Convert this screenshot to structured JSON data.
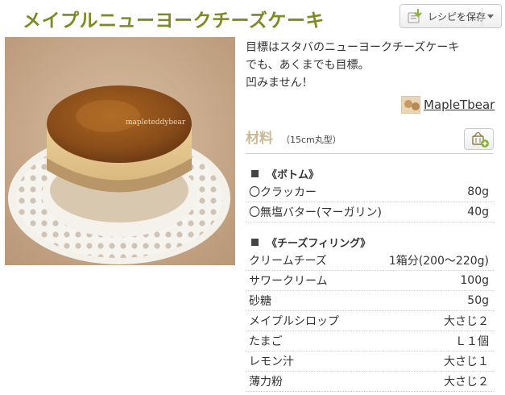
{
  "recipe": {
    "title": "メイプルニューヨークチーズケーキ",
    "description": [
      "目標はスタバのニューヨークチーズケーキ",
      "でも、あくまでも目標。",
      "凹みません！"
    ],
    "author": "MapleTbear",
    "photo_watermark": "mapleteddybear"
  },
  "toolbar": {
    "save_label": "レシピを保存"
  },
  "ingredients": {
    "heading": "材料",
    "serving_size": "（15cm丸型）",
    "sections": [
      {
        "title": "《ボトム》",
        "items": [
          {
            "name": "〇クラッカー",
            "amount": "80g"
          },
          {
            "name": "〇無塩バター(マーガリン)",
            "amount": "40g"
          }
        ]
      },
      {
        "title": "《チーズフィリング》",
        "items": [
          {
            "name": "クリームチーズ",
            "amount": "1箱分(200〜220g)"
          },
          {
            "name": "サワークリーム",
            "amount": "100g"
          },
          {
            "name": "砂糖",
            "amount": "50g"
          },
          {
            "name": "メイプルシロップ",
            "amount": "大さじ２"
          },
          {
            "name": "たまご",
            "amount": "Ｌ１個"
          },
          {
            "name": "レモン汁",
            "amount": "大さじ１"
          },
          {
            "name": "薄力粉",
            "amount": "大さじ２"
          }
        ]
      }
    ]
  },
  "colors": {
    "title": "#7f8a23",
    "ingredients_heading": "#c9b995",
    "save_icon": "#8bb33a"
  }
}
